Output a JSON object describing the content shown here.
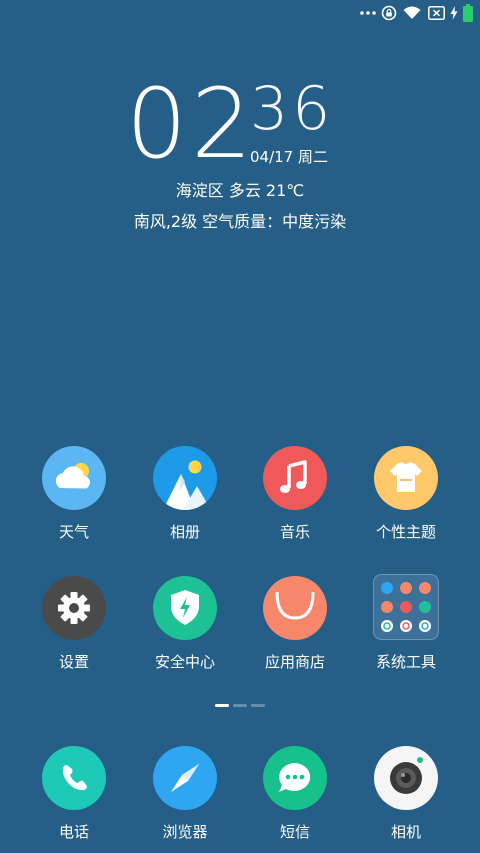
{
  "clock": {
    "hour": "02",
    "minute": "36",
    "date": "04/17 周二"
  },
  "weather": {
    "line": "海淀区 多云 21℃",
    "air": "南风,2级 空气质量：中度污染"
  },
  "status_bar": {
    "icons": [
      "more-dots-icon",
      "lock-rotation-icon",
      "wifi-icon",
      "no-sim-icon",
      "charging-icon",
      "battery-icon"
    ]
  },
  "apps": [
    {
      "label": "天气",
      "icon": "weather-icon",
      "color": "#5BB6F2"
    },
    {
      "label": "相册",
      "icon": "gallery-icon",
      "color": "#1E9BE8"
    },
    {
      "label": "音乐",
      "icon": "music-icon",
      "color": "#F0595A"
    },
    {
      "label": "个性主题",
      "icon": "theme-icon",
      "color": "#FFC96B"
    },
    {
      "label": "设置",
      "icon": "settings-icon",
      "color": "#4A4A4A"
    },
    {
      "label": "安全中心",
      "icon": "security-icon",
      "color": "#1DC195"
    },
    {
      "label": "应用商店",
      "icon": "app-store-icon",
      "color": "#F7876A"
    },
    {
      "label": "系统工具",
      "icon": "folder-icon",
      "color": "#3E7199"
    }
  ],
  "dock": [
    {
      "label": "电话",
      "icon": "phone-icon",
      "color": "#1FC9B8"
    },
    {
      "label": "浏览器",
      "icon": "compass-icon",
      "color": "#2EA6F2"
    },
    {
      "label": "短信",
      "icon": "message-icon",
      "color": "#17C18C"
    },
    {
      "label": "相机",
      "icon": "camera-icon",
      "color": "#F5F5F5"
    }
  ],
  "pages": {
    "count": 3,
    "active": 1
  }
}
